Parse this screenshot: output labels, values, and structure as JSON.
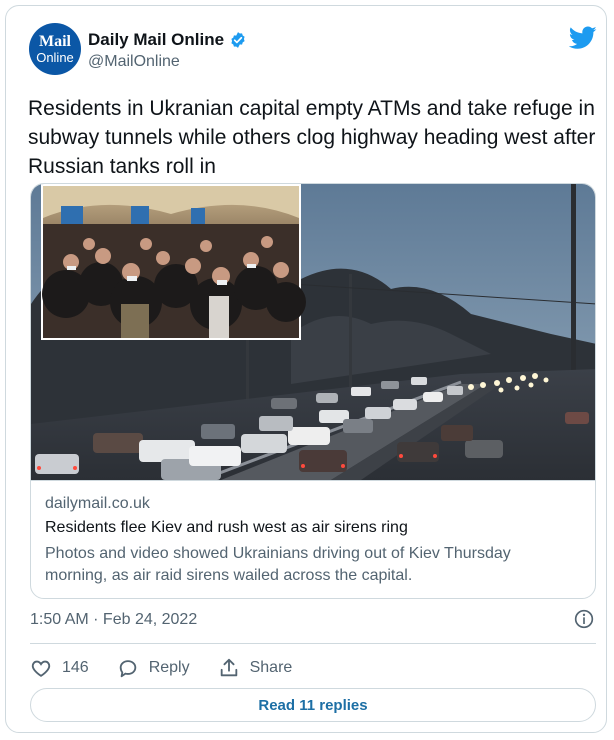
{
  "author": {
    "avatar_line1": "Mail",
    "avatar_line2": "Online",
    "name": "Daily Mail Online",
    "handle": "@MailOnline"
  },
  "tweet": {
    "text": "Residents in Ukranian capital empty ATMs and take refuge in subway tunnels while others clog highway heading west after Russian tanks roll in"
  },
  "link_card": {
    "domain": "dailymail.co.uk",
    "title": "Residents flee Kiev and rush west as air sirens ring",
    "description": "Photos and video showed Ukrainians driving out of Kiev Thursday morning, as air raid sirens wailed across the capital."
  },
  "meta": {
    "timestamp": "1:50 AM · Feb 24, 2022"
  },
  "actions": {
    "like_count": "146",
    "reply_label": "Reply",
    "share_label": "Share"
  },
  "read_replies_label": "Read 11 replies",
  "colors": {
    "brand_blue": "#1d9bf0",
    "text_secondary": "#536471",
    "border": "#cfd9de"
  },
  "icons": [
    "verified-badge-icon",
    "twitter-bird-icon",
    "info-icon",
    "heart-icon",
    "reply-bubble-icon",
    "share-icon"
  ]
}
